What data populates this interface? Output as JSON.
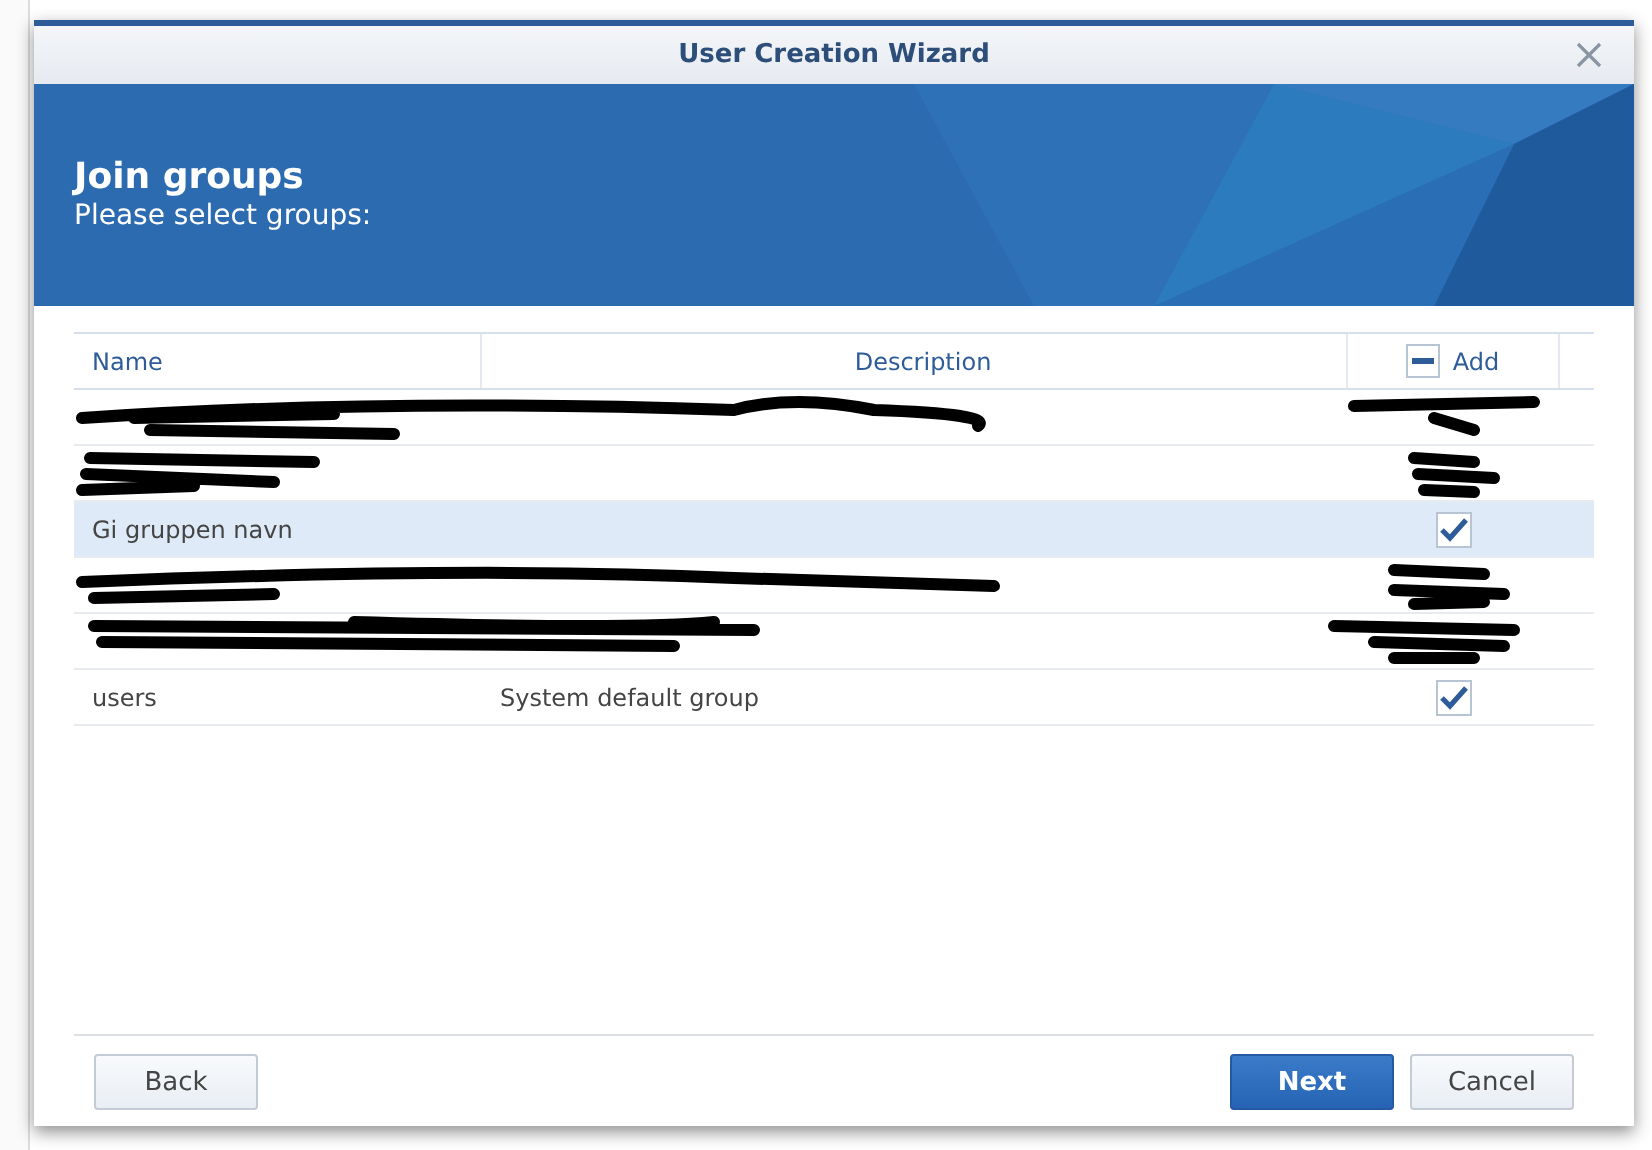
{
  "window": {
    "title": "User Creation Wizard"
  },
  "banner": {
    "title": "Join groups",
    "subtitle": "Please select groups:"
  },
  "table": {
    "columns": [
      "Name",
      "Description",
      "Add"
    ],
    "header_indeterminate": true,
    "rows": [
      {
        "kind": "redacted",
        "selected": false
      },
      {
        "kind": "redacted",
        "selected": false
      },
      {
        "kind": "group",
        "name": "Gi gruppen navn",
        "checked": true,
        "selected": true
      },
      {
        "kind": "redacted",
        "selected": false
      },
      {
        "kind": "redacted",
        "selected": false
      },
      {
        "kind": "group",
        "name": "users",
        "description": "System default group",
        "checked": true,
        "selected": false
      }
    ]
  },
  "buttons": [
    {
      "label": "Back",
      "kind": "secondary"
    },
    {
      "label": "Next",
      "kind": "primary"
    },
    {
      "label": "Cancel",
      "kind": "secondary"
    }
  ]
}
